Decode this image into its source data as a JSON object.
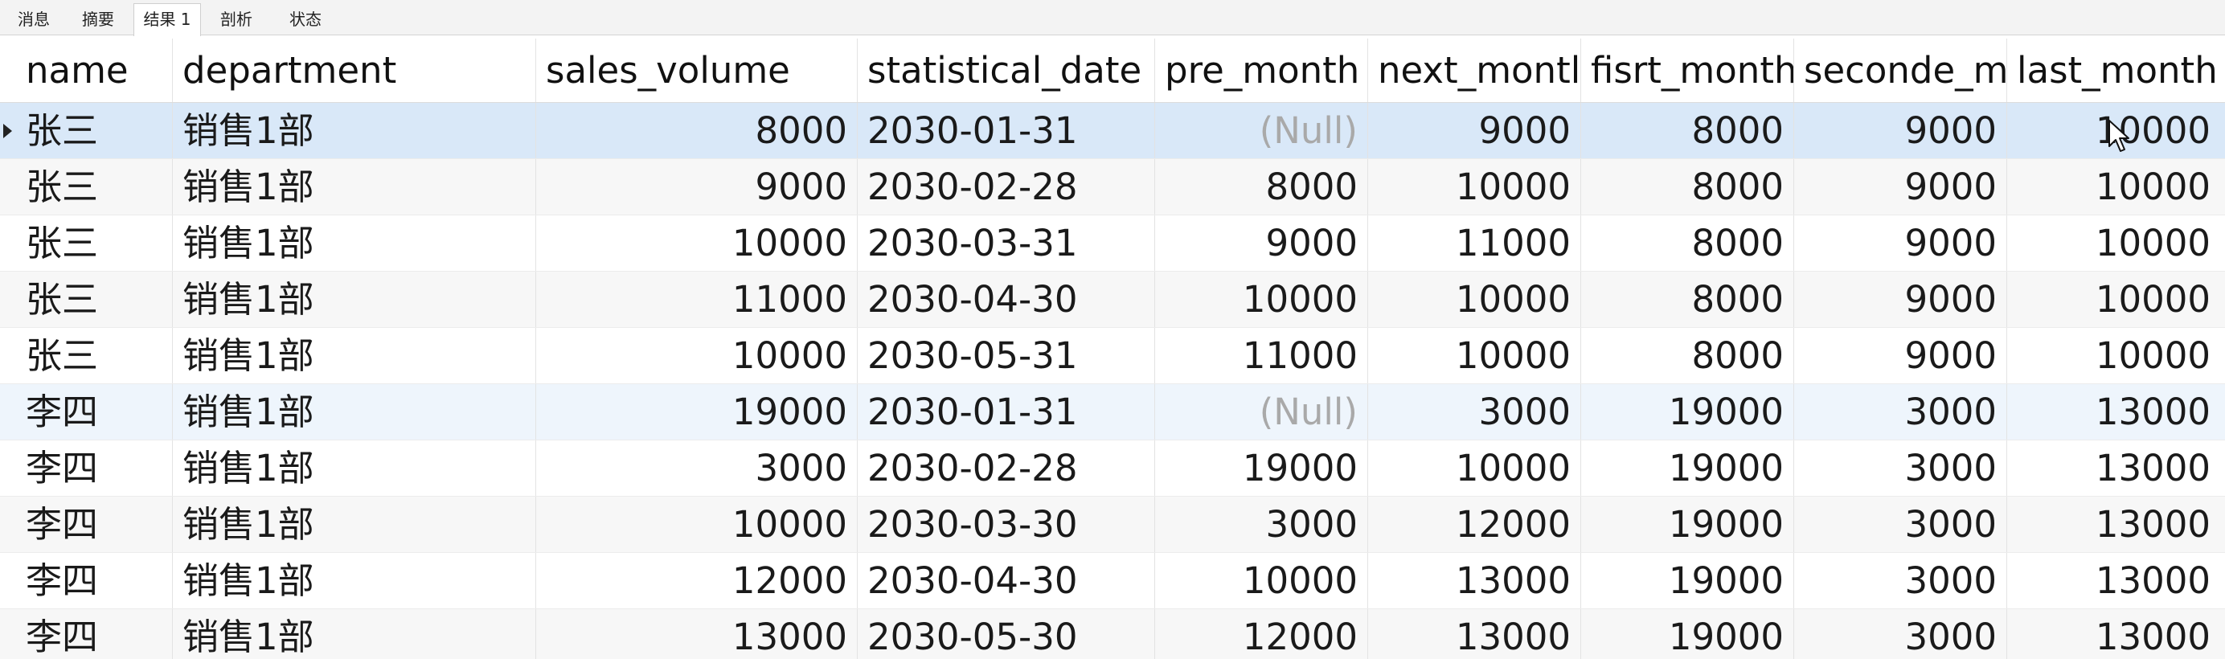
{
  "tabs": [
    {
      "label": "消息"
    },
    {
      "label": "摘要"
    },
    {
      "label": "结果 1"
    },
    {
      "label": "剖析"
    },
    {
      "label": "状态"
    }
  ],
  "active_tab": "结果 1",
  "columns": [
    "name",
    "department",
    "sales_volume",
    "statistical_date",
    "pre_month",
    "next_montl",
    "fisrt_month",
    "seconde_m",
    "last_month"
  ],
  "rows": [
    [
      "张三",
      "销售1部",
      "8000",
      "2030-01-31",
      "(Null)",
      "9000",
      "8000",
      "9000",
      "10000"
    ],
    [
      "张三",
      "销售1部",
      "9000",
      "2030-02-28",
      "8000",
      "10000",
      "8000",
      "9000",
      "10000"
    ],
    [
      "张三",
      "销售1部",
      "10000",
      "2030-03-31",
      "9000",
      "11000",
      "8000",
      "9000",
      "10000"
    ],
    [
      "张三",
      "销售1部",
      "11000",
      "2030-04-30",
      "10000",
      "10000",
      "8000",
      "9000",
      "10000"
    ],
    [
      "张三",
      "销售1部",
      "10000",
      "2030-05-31",
      "11000",
      "10000",
      "8000",
      "9000",
      "10000"
    ],
    [
      "李四",
      "销售1部",
      "19000",
      "2030-01-31",
      "(Null)",
      "3000",
      "19000",
      "3000",
      "13000"
    ],
    [
      "李四",
      "销售1部",
      "3000",
      "2030-02-28",
      "19000",
      "10000",
      "19000",
      "3000",
      "13000"
    ],
    [
      "李四",
      "销售1部",
      "10000",
      "2030-03-30",
      "3000",
      "12000",
      "19000",
      "3000",
      "13000"
    ],
    [
      "李四",
      "销售1部",
      "12000",
      "2030-04-30",
      "10000",
      "13000",
      "19000",
      "3000",
      "13000"
    ],
    [
      "李四",
      "销售1部",
      "13000",
      "2030-05-30",
      "12000",
      "13000",
      "19000",
      "3000",
      "13000"
    ]
  ]
}
